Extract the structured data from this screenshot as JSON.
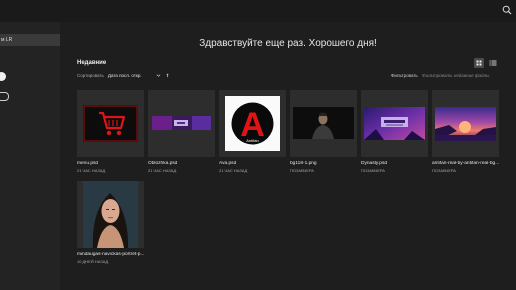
{
  "sidebar": {
    "item_label": "м LR"
  },
  "main": {
    "greeting": "Здравствуйте еще раз. Хорошего дня!",
    "section_title": "Недавние",
    "sort": {
      "label": "Сортировать",
      "value": "Дата посл. откр."
    },
    "filter": {
      "label": "Фильтровать",
      "placeholder": "Фильтровать недавние файлы"
    }
  },
  "files": [
    {
      "name": "menu.psd",
      "time": "21 ЧАС НАЗАД",
      "thumb": "cart-icon"
    },
    {
      "name": "Oblozhka.psd",
      "time": "21 ЧАС НАЗАД",
      "thumb": "banner"
    },
    {
      "name": "Ava.psd",
      "time": "21 ЧАС НАЗАД",
      "thumb": "avatar-logo"
    },
    {
      "name": "bg118-1.png",
      "time": "ПОЗАВЧЕРА",
      "thumb": "portrait-man"
    },
    {
      "name": "Dynasty.psd",
      "time": "ПОЗАВЧЕРА",
      "thumb": "dynasty-banner"
    },
    {
      "name": "antifan-real-by-antifan-real-bg...",
      "time": "ПОЗАВЧЕРА",
      "thumb": "sunset-scene"
    },
    {
      "name": "mindaugas-navickas-portret-p...",
      "time": "10 ДНЕЙ НАЗАД",
      "thumb": "portrait-woman"
    }
  ],
  "thumbs": {
    "avatar_letter": "A",
    "avatar_caption": "Antifan"
  },
  "colors": {
    "accent_red": "#e01414",
    "background": "#1e1e1e"
  }
}
